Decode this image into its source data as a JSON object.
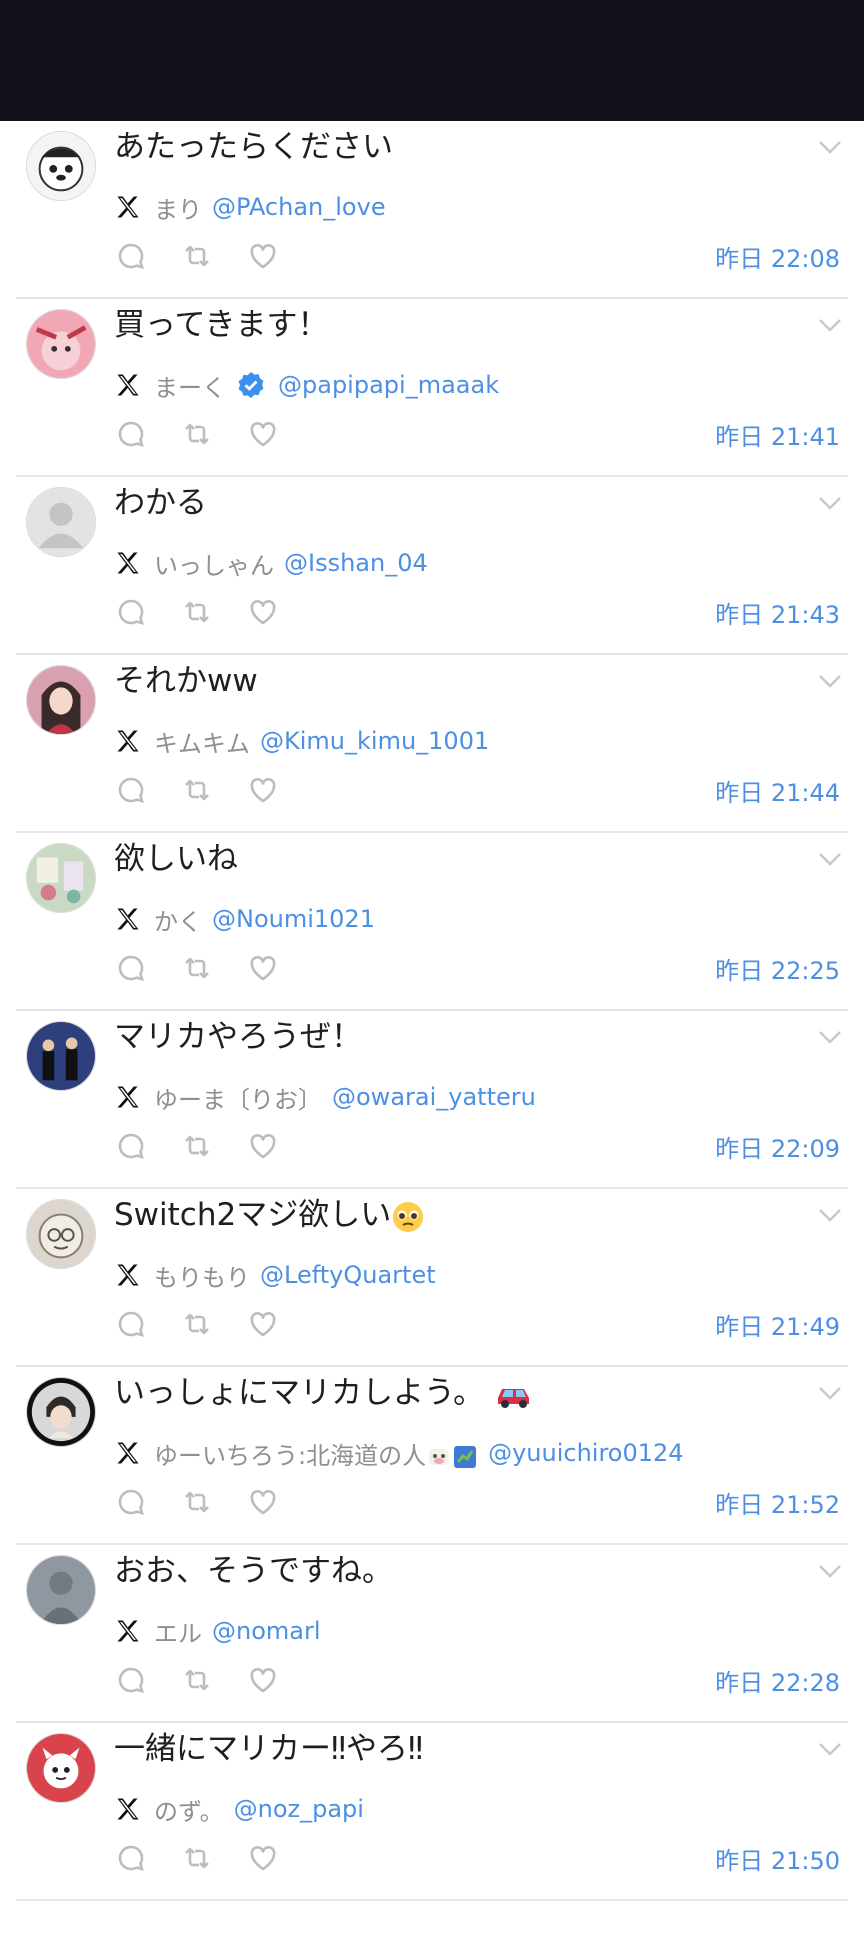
{
  "feed": {
    "tweets": [
      {
        "text": "あたったらください",
        "name": "まり",
        "handle": "@PAchan_love",
        "time": "昨日 22:08",
        "verified": false,
        "avatar_color": "#f4f4f4"
      },
      {
        "text": "買ってきます！",
        "name": "まーく",
        "handle": "@papipapi_maaak",
        "time": "昨日 21:41",
        "verified": true,
        "avatar_color": "#f2a7b4"
      },
      {
        "text": "わかる",
        "name": "いっしゃん",
        "handle": "@Isshan_04",
        "time": "昨日 21:43",
        "verified": false,
        "avatar_color": "#e3e3e3"
      },
      {
        "text": "それかww",
        "name": "キムキム",
        "handle": "@Kimu_kimu_1001",
        "time": "昨日 21:44",
        "verified": false,
        "avatar_color": "#d9a0b0"
      },
      {
        "text": "欲しいね",
        "name": "かく",
        "handle": "@Noumi1021",
        "time": "昨日 22:25",
        "verified": false,
        "avatar_color": "#c9d9c4"
      },
      {
        "text": "マリカやろうぜ！",
        "name": "ゆーま〔りお〕",
        "handle": "@owarai_yatteru",
        "time": "昨日 22:09",
        "verified": false,
        "avatar_color": "#2d3f7c"
      },
      {
        "text": "Switch2マジ欲しい",
        "name": "もりもり",
        "handle": "@LeftyQuartet",
        "time": "昨日 21:49",
        "verified": false,
        "avatar_color": "#dcd6cf",
        "emoji": "pleading-face"
      },
      {
        "text": "いっしょにマリカしよう。",
        "name": "ゆーいちろう:北海道の人",
        "handle": "@yuuichiro0124",
        "time": "昨日 21:52",
        "verified": false,
        "avatar_color": "#d8d8d8",
        "emoji": "red-car",
        "name_emoji": true
      },
      {
        "text": "おお、そうですね。",
        "name": "エル",
        "handle": "@nomarl",
        "time": "昨日 22:28",
        "verified": false,
        "avatar_color": "#7c8590"
      },
      {
        "text": "一緒にマリカー‼やろ‼",
        "name": "のず。",
        "handle": "@noz_papi",
        "time": "昨日 21:50",
        "verified": false,
        "avatar_color": "#d8434c"
      }
    ]
  },
  "icons": {
    "platform": "x-logo-icon",
    "reply": "reply-icon",
    "retweet": "retweet-icon",
    "like": "like-icon",
    "menu": "chevron-down-icon",
    "verified": "verified-badge-icon"
  },
  "colors": {
    "topbar": "#12131a",
    "accent": "#4c8fe3",
    "muted": "#8e8e93",
    "divider": "#e6e6e8"
  }
}
